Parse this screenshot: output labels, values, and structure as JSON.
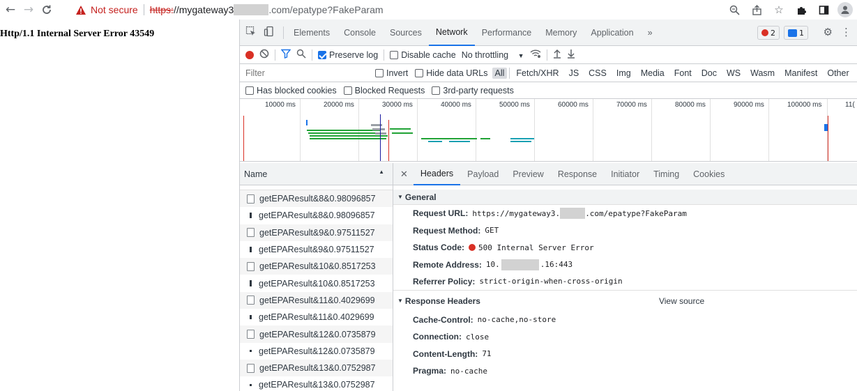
{
  "browser": {
    "back": "←",
    "forward": "→",
    "reload": "C",
    "not_secure": "Not secure",
    "url_scheme": "https:",
    "url_host_prefix": "//mygateway3",
    "url_rest": ".com/epatype?FakeParam"
  },
  "page": {
    "error_text": "Http/1.1 Internal Server Error 43549"
  },
  "devtools": {
    "tabs": [
      "Elements",
      "Console",
      "Sources",
      "Network",
      "Performance",
      "Memory",
      "Application"
    ],
    "more": "»",
    "error_count": "2",
    "message_count": "1",
    "toolbar": {
      "preserve_log": "Preserve log",
      "disable_cache": "Disable cache",
      "throttling": "No throttling"
    },
    "filter": {
      "placeholder": "Filter",
      "invert": "Invert",
      "hide_data_urls": "Hide data URLs",
      "types": [
        "All",
        "Fetch/XHR",
        "JS",
        "CSS",
        "Img",
        "Media",
        "Font",
        "Doc",
        "WS",
        "Wasm",
        "Manifest",
        "Other"
      ]
    },
    "blocked": {
      "has_blocked_cookies": "Has blocked cookies",
      "blocked_requests": "Blocked Requests",
      "third_party": "3rd-party requests"
    },
    "timeline_ticks": [
      "10000 ms",
      "20000 ms",
      "30000 ms",
      "40000 ms",
      "50000 ms",
      "60000 ms",
      "70000 ms",
      "80000 ms",
      "90000 ms",
      "100000 ms",
      "11("
    ],
    "name_header": "Name",
    "requests": [
      {
        "name": "getEPAResult&8&0.98096857",
        "icon": "doc"
      },
      {
        "name": "getEPAResult&8&0.98096857",
        "icon": "bar"
      },
      {
        "name": "getEPAResult&9&0.97511527",
        "icon": "doc"
      },
      {
        "name": "getEPAResult&9&0.97511527",
        "icon": "bar"
      },
      {
        "name": "getEPAResult&10&0.8517253",
        "icon": "doc"
      },
      {
        "name": "getEPAResult&10&0.8517253",
        "icon": "bar"
      },
      {
        "name": "getEPAResult&11&0.4029699",
        "icon": "doc"
      },
      {
        "name": "getEPAResult&11&0.4029699",
        "icon": "bar"
      },
      {
        "name": "getEPAResult&12&0.0735879",
        "icon": "doc"
      },
      {
        "name": "getEPAResult&12&0.0735879",
        "icon": "bar"
      },
      {
        "name": "getEPAResult&13&0.0752987",
        "icon": "doc"
      },
      {
        "name": "getEPAResult&13&0.0752987",
        "icon": "bar"
      }
    ],
    "detail_tabs": [
      "Headers",
      "Payload",
      "Preview",
      "Response",
      "Initiator",
      "Timing",
      "Cookies"
    ],
    "general": {
      "title": "General",
      "request_url_key": "Request URL:",
      "request_url_prefix": "https://mygateway3.",
      "request_url_suffix": ".com/epatype?FakeParam",
      "request_method_key": "Request Method:",
      "request_method": "GET",
      "status_code_key": "Status Code:",
      "status_code": "500 Internal Server Error",
      "remote_address_key": "Remote Address:",
      "remote_address_prefix": "10.",
      "remote_address_suffix": ".16:443",
      "referrer_policy_key": "Referrer Policy:",
      "referrer_policy": "strict-origin-when-cross-origin"
    },
    "response_headers": {
      "title": "Response Headers",
      "view_source": "View source",
      "items": [
        {
          "key": "Cache-Control:",
          "value": "no-cache,no-store"
        },
        {
          "key": "Connection:",
          "value": "close"
        },
        {
          "key": "Content-Length:",
          "value": "71"
        },
        {
          "key": "Pragma:",
          "value": "no-cache"
        }
      ]
    }
  }
}
